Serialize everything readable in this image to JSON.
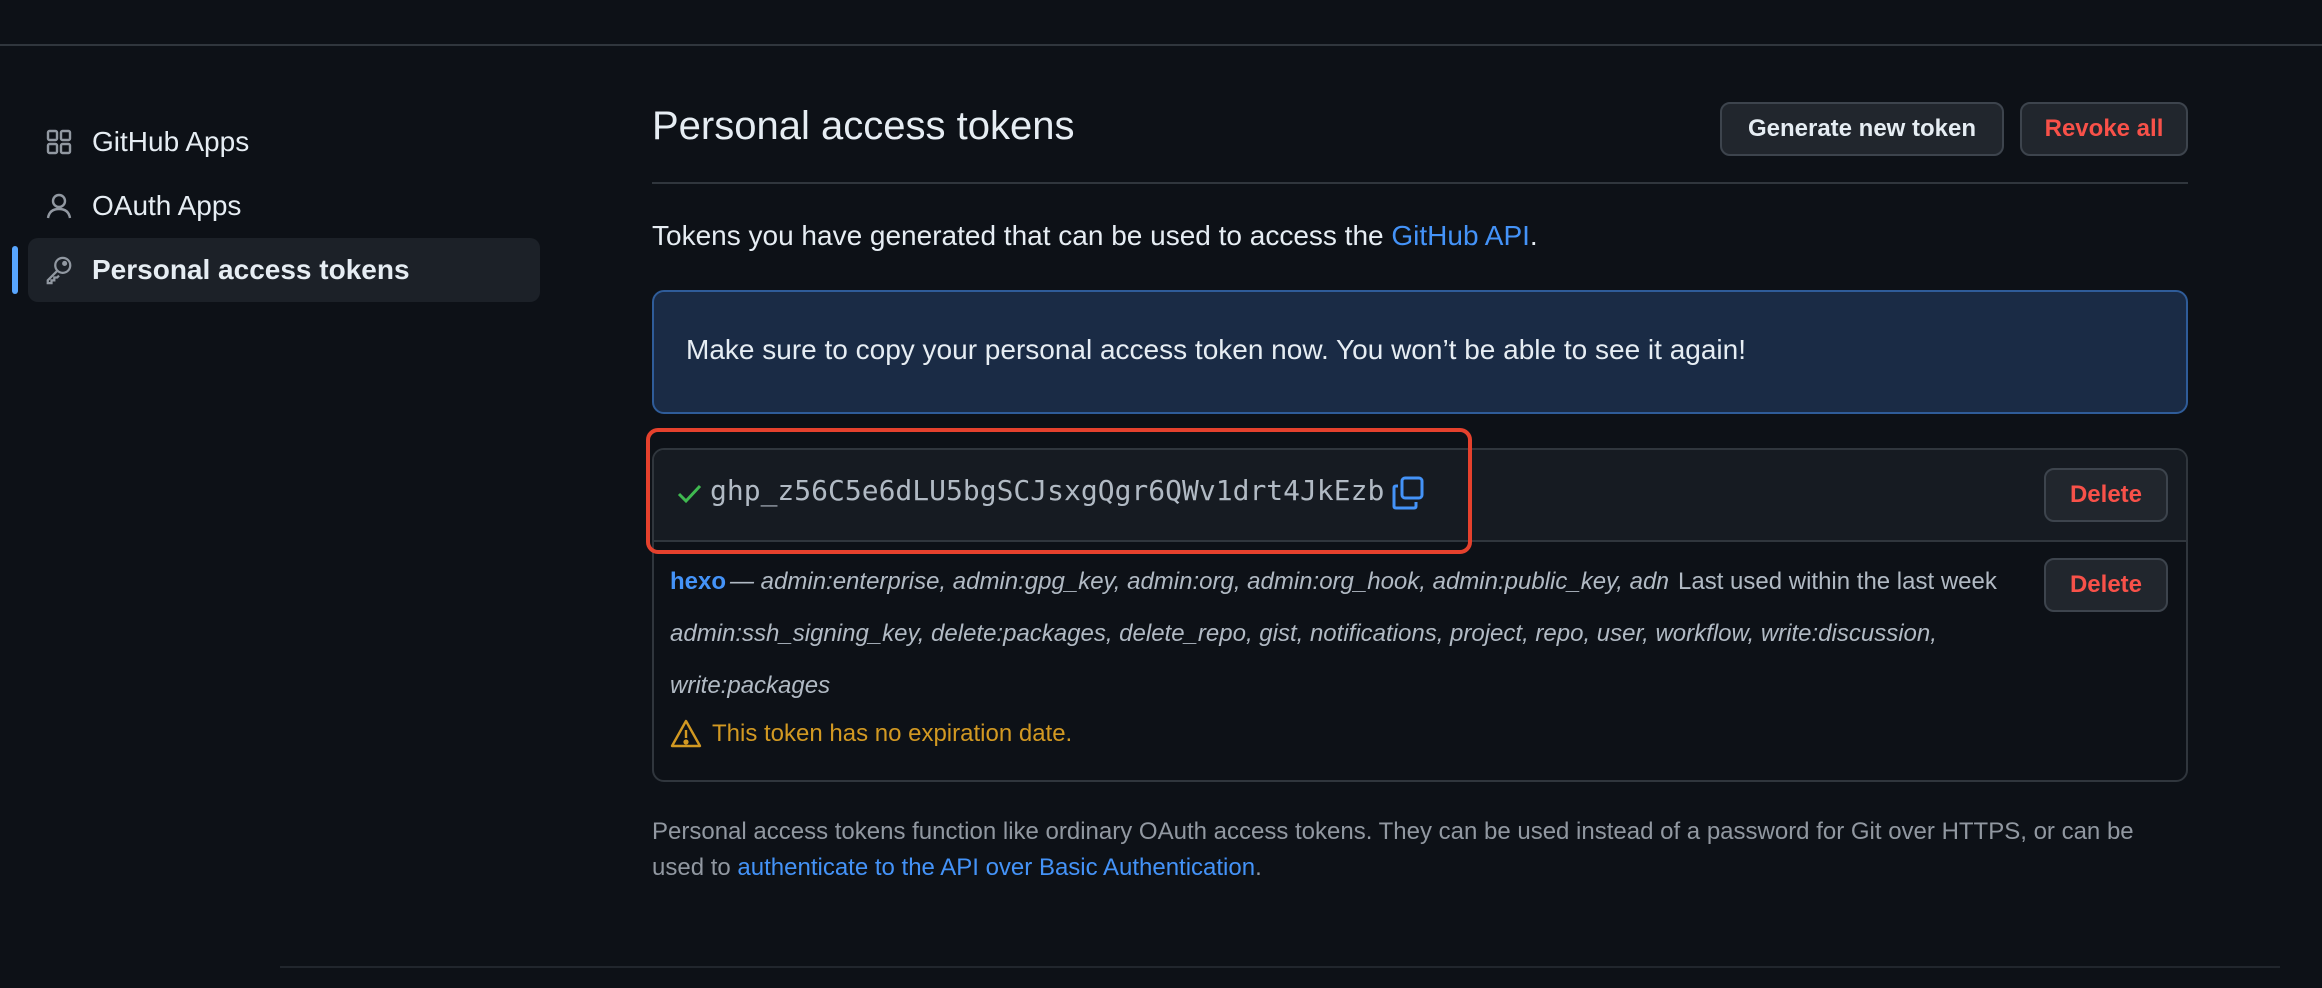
{
  "sidebar": {
    "items": [
      {
        "label": "GitHub Apps",
        "icon": "apps-grid-icon",
        "active": false
      },
      {
        "label": "OAuth Apps",
        "icon": "person-icon",
        "active": false
      },
      {
        "label": "Personal access tokens",
        "icon": "key-icon",
        "active": true
      }
    ]
  },
  "header": {
    "title": "Personal access tokens",
    "generate_label": "Generate new token",
    "revoke_label": "Revoke all"
  },
  "intro": {
    "text": "Tokens you have generated that can be used to access the ",
    "link": "GitHub API",
    "suffix": "."
  },
  "flash": {
    "message": "Make sure to copy your personal access token now. You won’t be able to see it again!"
  },
  "tokens": {
    "new_token": {
      "value": "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",
      "delete_label": "Delete"
    },
    "existing": {
      "name": "hexo",
      "separator": " — ",
      "scopes": "admin:enterprise, admin:gpg_key, admin:org, admin:org_hook, admin:public_key, admin:repo_hook, admin:ssh_signing_key, delete:packages, delete_repo, gist, notifications, project, repo, user, workflow, write:discussion, write:packages",
      "last_used": "Last used within the last week",
      "delete_label": "Delete",
      "warning": "This token has no expiration date."
    }
  },
  "footnote": {
    "text": "Personal access tokens function like ordinary OAuth access tokens. They can be used instead of a password for Git over HTTPS, or can be used to ",
    "link": "authenticate to the API over Basic Authentication",
    "suffix": "."
  },
  "colors": {
    "background": "#0d1117",
    "link": "#4493f8",
    "danger": "#f85149",
    "warning": "#d29922",
    "success": "#3fb950",
    "highlight": "#e5412d"
  }
}
